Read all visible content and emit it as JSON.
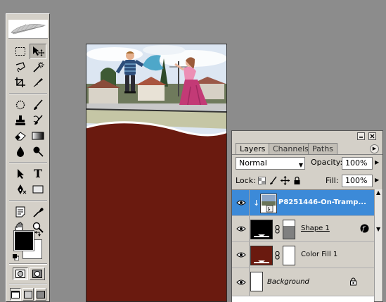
{
  "toolbox": {
    "tools": [
      {
        "name": "marquee-tool-icon"
      },
      {
        "name": "move-tool-icon",
        "selected": true
      },
      {
        "name": "lasso-tool-icon"
      },
      {
        "name": "magic-wand-tool-icon"
      },
      {
        "name": "crop-tool-icon"
      },
      {
        "name": "slice-tool-icon"
      },
      {
        "name": "healing-brush-tool-icon"
      },
      {
        "name": "brush-tool-icon"
      },
      {
        "name": "clone-stamp-tool-icon"
      },
      {
        "name": "history-brush-tool-icon"
      },
      {
        "name": "eraser-tool-icon"
      },
      {
        "name": "gradient-tool-icon"
      },
      {
        "name": "blur-tool-icon"
      },
      {
        "name": "dodge-tool-icon"
      },
      {
        "name": "path-selection-tool-icon"
      },
      {
        "name": "type-tool-icon"
      },
      {
        "name": "pen-tool-icon"
      },
      {
        "name": "rectangle-shape-tool-icon"
      },
      {
        "name": "notes-tool-icon"
      },
      {
        "name": "eyedropper-tool-icon"
      },
      {
        "name": "hand-tool-icon"
      },
      {
        "name": "zoom-tool-icon"
      }
    ],
    "foreground_color": "#000000",
    "background_color": "#ffffff",
    "type_tool_glyph": "T"
  },
  "document": {
    "canvas_fill_color": "#6a1a0f"
  },
  "layers_panel": {
    "tabs": [
      {
        "label": "Layers",
        "active": true
      },
      {
        "label": "Channels",
        "active": false
      },
      {
        "label": "Paths",
        "active": false
      }
    ],
    "blend_mode": "Normal",
    "opacity_label": "Opacity:",
    "opacity_value": "100%",
    "lock_label": "Lock:",
    "fill_label": "Fill:",
    "fill_value": "100%",
    "layers": [
      {
        "name": "P8251446-On-Tramp...",
        "visible": true,
        "selected": true,
        "kind": "clipped-photo"
      },
      {
        "name": "Shape 1",
        "visible": true,
        "selected": false,
        "kind": "shape",
        "thumb_color": "#000000"
      },
      {
        "name": "Color Fill 1",
        "visible": true,
        "selected": false,
        "kind": "fill",
        "thumb_color": "#6a1a0f"
      },
      {
        "name": "Background",
        "visible": true,
        "selected": false,
        "kind": "background",
        "locked": true
      }
    ]
  },
  "colors": {
    "app_bg": "#8c8c8c",
    "panel_bg": "#d4d0c8",
    "selection_blue": "#3c8ad8",
    "canvas_red": "#6a1a0f"
  }
}
